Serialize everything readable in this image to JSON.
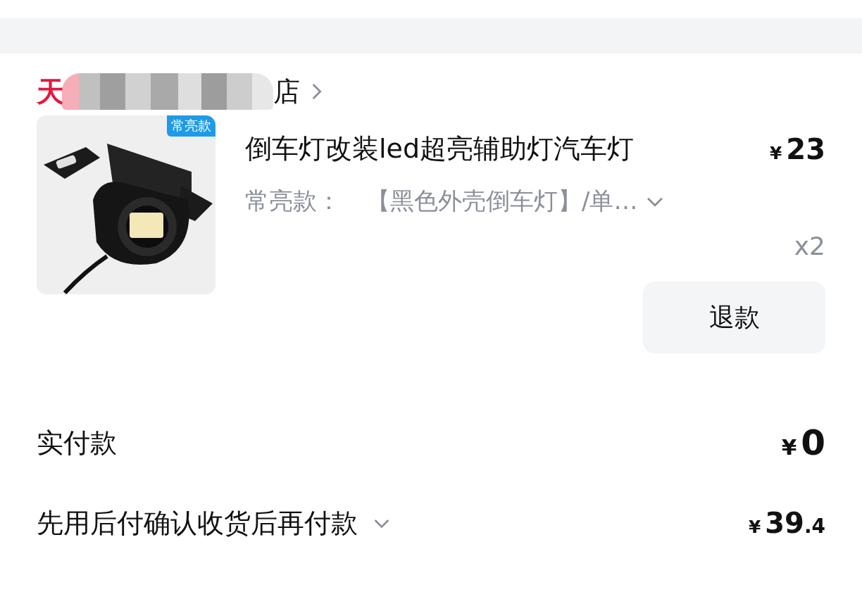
{
  "store": {
    "logo": "天",
    "name_visible": "店",
    "redacted": true
  },
  "item": {
    "image": {
      "kind": "picture",
      "badge": "常亮款"
    },
    "title": "倒车灯改装led超亮辅助灯汽车灯",
    "price": "¥23",
    "spec_label": "常亮款：",
    "spec_value": "【黑色外壳倒车灯】/单…",
    "quantity": "x2",
    "refund_button": "退款"
  },
  "summary": [
    {
      "label": "实付款",
      "amount": "¥0",
      "expandable": false
    },
    {
      "label": "先用后付确认收货后再付款",
      "amount": "¥39.4",
      "expandable": true
    }
  ]
}
